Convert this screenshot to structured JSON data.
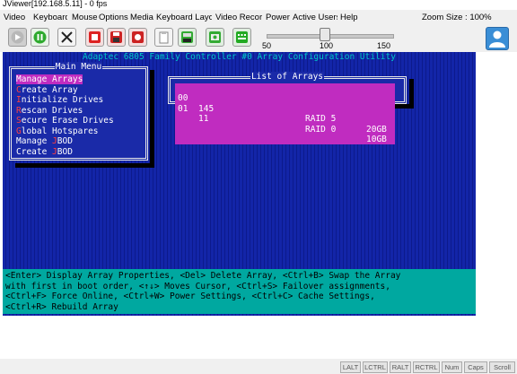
{
  "window": {
    "title": "JViewer[192.168.5.11] - 0 fps"
  },
  "menubar": {
    "items": [
      "Video",
      "Keyboard",
      "Mouse",
      "Options",
      "Media",
      "Keyboard Layout",
      "Video Record",
      "Power",
      "Active Users",
      "Help"
    ],
    "zoom_label": "Zoom Size : 100%"
  },
  "toolbar": {
    "buttons": [
      "play-icon",
      "pause-icon",
      "fullscreen-icon",
      "stop-record-icon",
      "save-icon",
      "record-icon",
      "clipboard-icon",
      "floppy-media-icon",
      "cd-media-icon",
      "keyboard-icon",
      "user-icon"
    ],
    "zoom_slider": {
      "min_label": "50",
      "mid_label": "100",
      "max_label": "150",
      "value": 100
    }
  },
  "screen": {
    "title": "Adaptec 6805 Family Controller #0 Array Configuration Utility",
    "main_menu": {
      "title": "Main Menu",
      "items": [
        {
          "hot": "M",
          "rest": "anage Arrays",
          "selected": true
        },
        {
          "hot": "C",
          "rest": "reate Array"
        },
        {
          "hot": "I",
          "rest": "nitialize Drives"
        },
        {
          "hot": "R",
          "rest": "escan Drives"
        },
        {
          "hot": "S",
          "rest": "ecure Erase Drives"
        },
        {
          "hot": "G",
          "rest": "lobal Hotspares"
        },
        {
          "pre": "Manage ",
          "hot": "J",
          "rest": "BOD"
        },
        {
          "pre": "Create ",
          "hot": "J",
          "rest": "BOD"
        }
      ]
    },
    "list_of_arrays": {
      "title": "List of Arrays",
      "rows": [
        {
          "id": "00",
          "name": "145",
          "raid": "RAID 5",
          "size": "20GB",
          "selected": true
        },
        {
          "id": "01",
          "name": "11",
          "raid": "RAID 0",
          "size": "10GB"
        }
      ]
    },
    "help_lines": [
      "<Enter> Display Array Properties, <Del> Delete Array, <Ctrl+B> Swap the Array",
      "with first in boot order, <↑↓> Moves Cursor, <Ctrl+S> Failover assignments,",
      "<Ctrl+F> Force Online, <Ctrl+W> Power Settings, <Ctrl+C> Cache Settings,",
      "<Ctrl+R> Rebuild Array"
    ]
  },
  "statusbar": {
    "keys": [
      "LALT",
      "LCTRL",
      "RALT",
      "RCTRL",
      "Num",
      "Caps",
      "Scroll"
    ]
  }
}
